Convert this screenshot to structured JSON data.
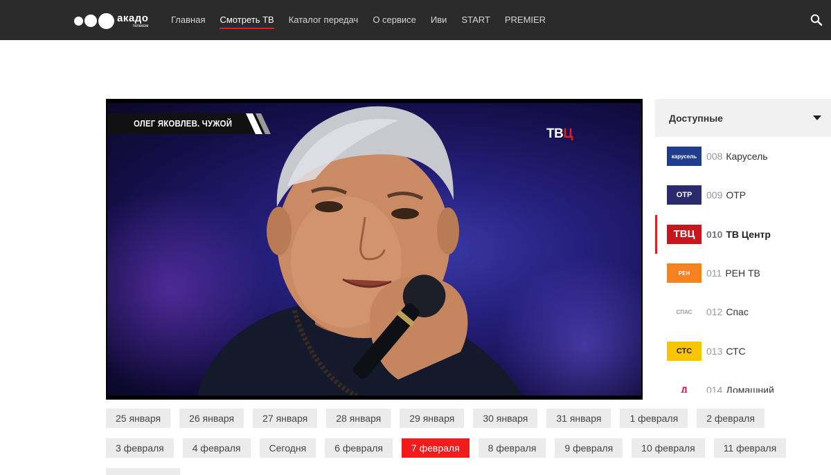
{
  "header": {
    "logo": {
      "main": "акадо",
      "sub": "телеком"
    },
    "nav": [
      {
        "label": "Главная",
        "active": false
      },
      {
        "label": "Смотреть ТВ",
        "active": true
      },
      {
        "label": "Каталог передач",
        "active": false
      },
      {
        "label": "О сервисе",
        "active": false
      },
      {
        "label": "Иви",
        "active": false
      },
      {
        "label": "START",
        "active": false
      },
      {
        "label": "PREMIER",
        "active": false
      }
    ],
    "search_icon": "search-icon"
  },
  "player": {
    "caption": "ОЛЕГ ЯКОВЛЕВ. ЧУЖОЙ",
    "bug_main": "ТВ",
    "bug_accent": "Ц"
  },
  "channels": {
    "filter_label": "Доступные",
    "items": [
      {
        "num": "008",
        "name": "Карусель",
        "logo": "карусель",
        "logo_bg": "#1f3c8f",
        "logo_fg": "#ffffff",
        "active": false
      },
      {
        "num": "009",
        "name": "ОТР",
        "logo": "ОТР",
        "logo_bg": "#2b2a6e",
        "logo_fg": "#ffffff",
        "active": false
      },
      {
        "num": "010",
        "name": "ТВ Центр",
        "logo": "ТВЦ",
        "logo_bg": "#c8161d",
        "logo_fg": "#ffffff",
        "active": true
      },
      {
        "num": "011",
        "name": "РЕН ТВ",
        "logo": "РЕН",
        "logo_bg": "#f5821f",
        "logo_fg": "#ffffff",
        "active": false
      },
      {
        "num": "012",
        "name": "Спас",
        "logo": "СПАС",
        "logo_bg": "#ffffff",
        "logo_fg": "#9a9a9a",
        "active": false
      },
      {
        "num": "013",
        "name": "СТС",
        "logo": "СТС",
        "logo_bg": "#f7c600",
        "logo_fg": "#1a1a1a",
        "active": false
      },
      {
        "num": "014",
        "name": "Домашний",
        "logo": "Д",
        "logo_bg": "#ffffff",
        "logo_fg": "#c2185b",
        "active": false
      }
    ]
  },
  "dates": {
    "row1": [
      "25 января",
      "26 января",
      "27 января",
      "28 января",
      "29 января",
      "30 января",
      "31 января",
      "1 февраля",
      "2 февраля"
    ],
    "row2": [
      "3 февраля",
      "4 февраля",
      "Сегодня",
      "6 февраля",
      "7 февраля",
      "8 февраля",
      "9 февраля",
      "10 февраля",
      "11 февраля"
    ],
    "selected": "7 февраля"
  },
  "colors": {
    "accent": "#e01e1e",
    "header_bg": "#2b2b2b"
  }
}
